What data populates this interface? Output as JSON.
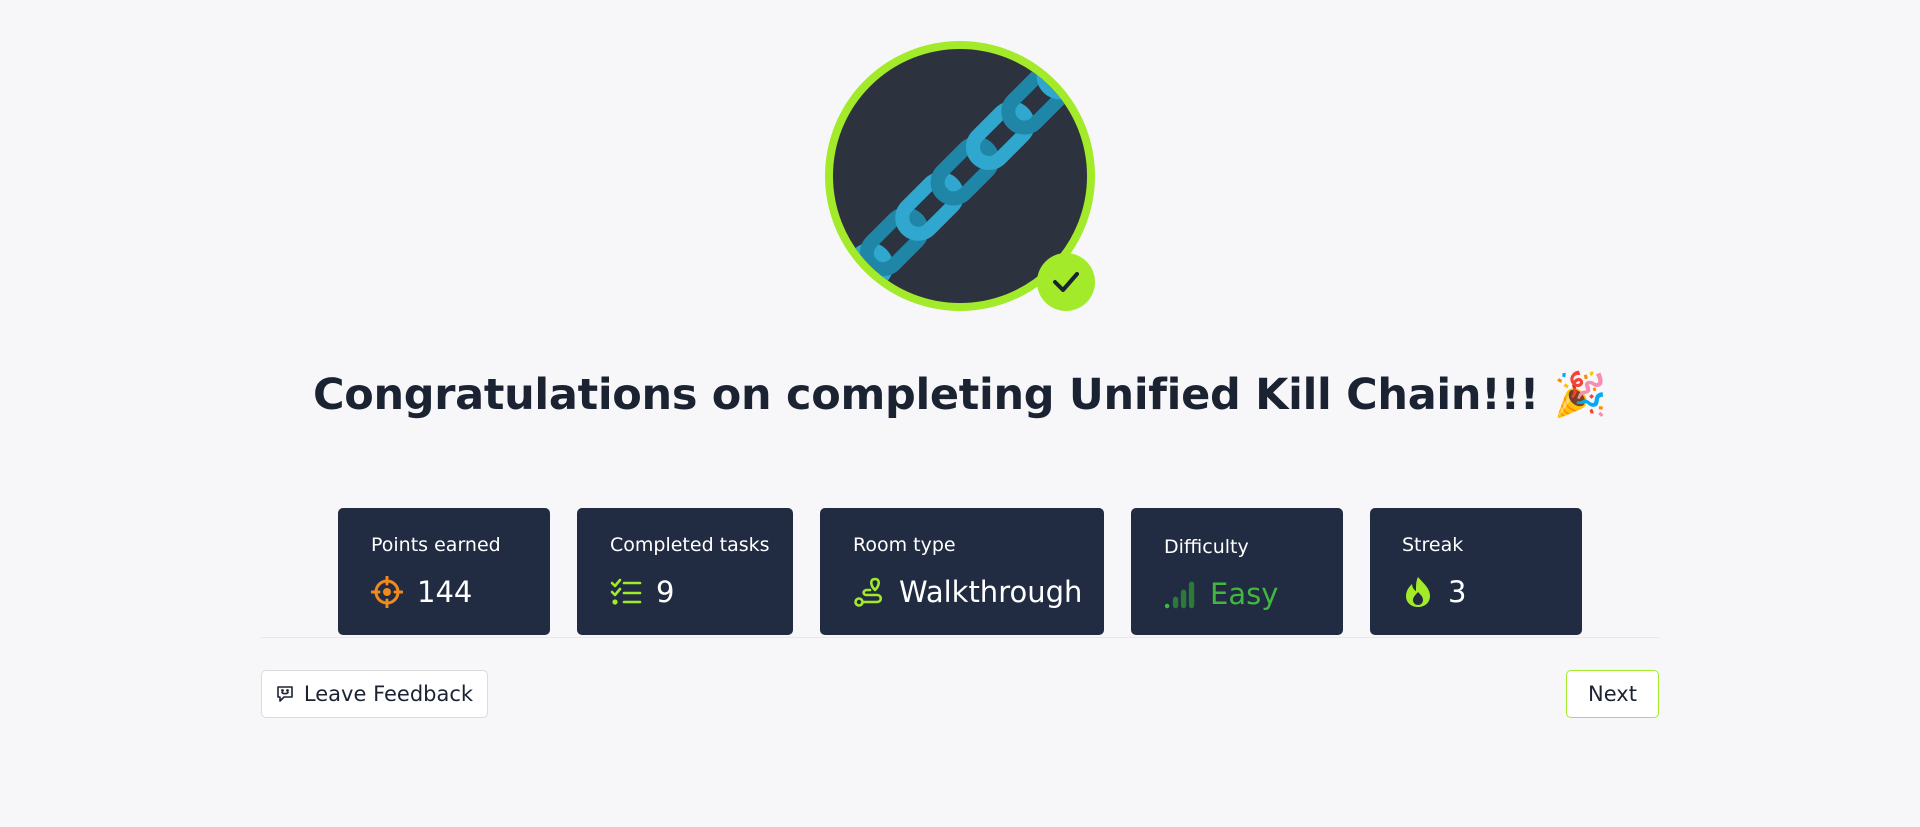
{
  "title": "Congratulations on completing Unified Kill Chain!!! 🎉",
  "colors": {
    "accent": "#a3ea2a",
    "card_bg": "#212c42",
    "badge_bg": "#2c323e",
    "chain": "#2fa7cf",
    "points_icon": "#f08a1c",
    "easy": "#40b83e"
  },
  "badge": {
    "image": "chain-icon",
    "status_icon": "checkmark-icon"
  },
  "stats": {
    "points": {
      "label": "Points earned",
      "value": "144",
      "icon": "target-icon"
    },
    "tasks": {
      "label": "Completed tasks",
      "value": "9",
      "icon": "checklist-icon"
    },
    "room_type": {
      "label": "Room type",
      "value": "Walkthrough",
      "icon": "route-icon"
    },
    "difficulty": {
      "label": "Difficulty",
      "value": "Easy",
      "icon": "signal-bars-icon"
    },
    "streak": {
      "label": "Streak",
      "value": "3",
      "icon": "flame-icon"
    }
  },
  "actions": {
    "feedback_label": "Leave Feedback",
    "feedback_icon": "message-icon",
    "next_label": "Next"
  }
}
